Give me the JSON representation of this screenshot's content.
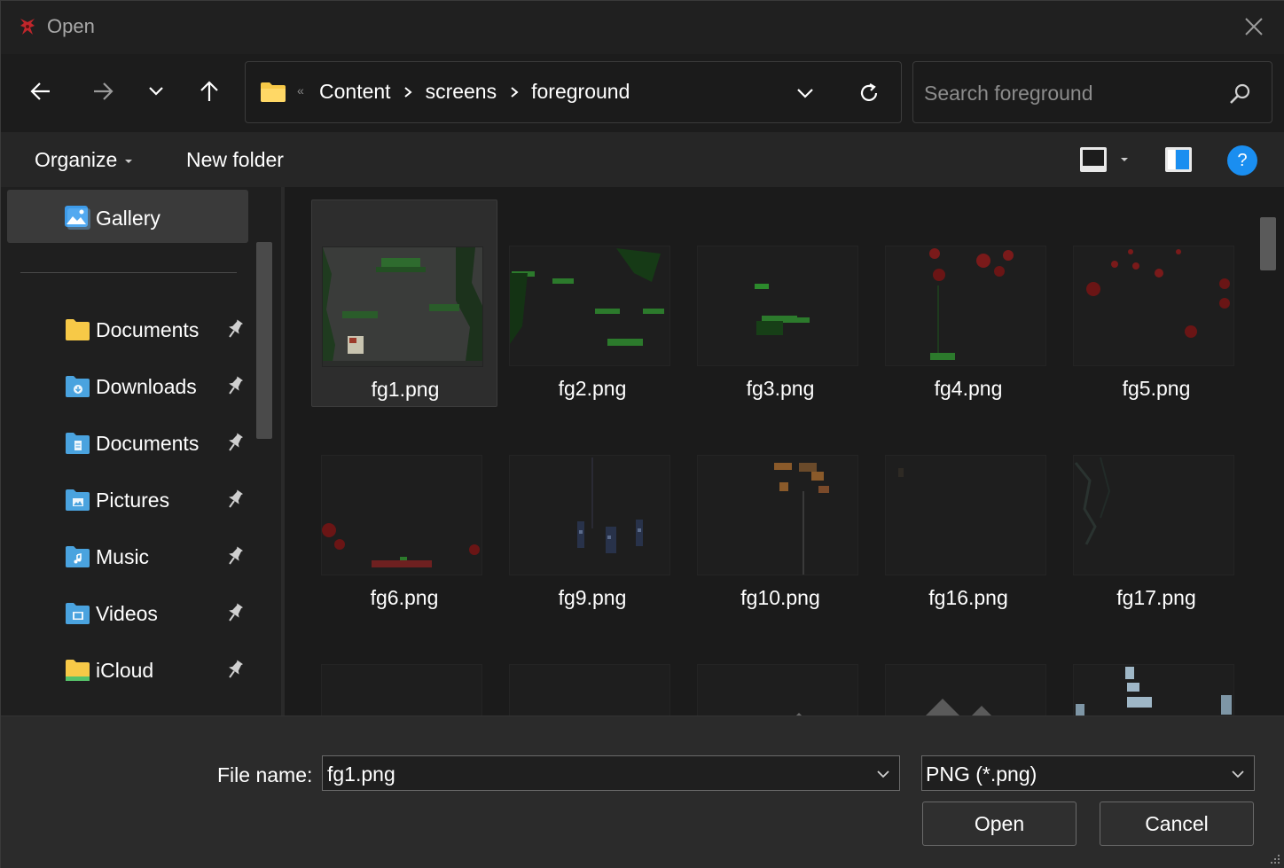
{
  "window": {
    "title": "Open",
    "close_icon": "close-icon",
    "app_icon": "app-icon"
  },
  "nav": {
    "back_icon": "arrow-left-icon",
    "forward_icon": "arrow-right-icon",
    "recent_icon": "chevron-down-icon",
    "up_icon": "arrow-up-icon",
    "address": {
      "overflow_indicator": "«",
      "crumbs": [
        "Content",
        "screens",
        "foreground"
      ]
    },
    "refresh_icon": "refresh-icon",
    "search": {
      "placeholder": "Search foreground"
    }
  },
  "toolbar": {
    "organize_label": "Organize",
    "new_folder_label": "New folder",
    "help_label": "?"
  },
  "sidebar": {
    "gallery_label": "Gallery",
    "items": [
      {
        "label": "Documents",
        "icon": "folder-icon",
        "color": "#f7c948",
        "pinned": true
      },
      {
        "label": "Downloads",
        "icon": "downloads-folder-icon",
        "color": "#4aa3df",
        "pinned": true
      },
      {
        "label": "Documents",
        "icon": "documents-folder-icon",
        "color": "#4aa3df",
        "pinned": true
      },
      {
        "label": "Pictures",
        "icon": "pictures-folder-icon",
        "color": "#4aa3df",
        "pinned": true
      },
      {
        "label": "Music",
        "icon": "music-folder-icon",
        "color": "#4aa3df",
        "pinned": true
      },
      {
        "label": "Videos",
        "icon": "videos-folder-icon",
        "color": "#4aa3df",
        "pinned": true
      },
      {
        "label": "iCloud",
        "icon": "icloud-folder-icon",
        "color": "#f7c948",
        "pinned": true
      }
    ]
  },
  "files": [
    {
      "name": "fg1.png",
      "selected": true
    },
    {
      "name": "fg2.png",
      "selected": false
    },
    {
      "name": "fg3.png",
      "selected": false
    },
    {
      "name": "fg4.png",
      "selected": false
    },
    {
      "name": "fg5.png",
      "selected": false
    },
    {
      "name": "fg6.png",
      "selected": false
    },
    {
      "name": "fg9.png",
      "selected": false
    },
    {
      "name": "fg10.png",
      "selected": false
    },
    {
      "name": "fg16.png",
      "selected": false
    },
    {
      "name": "fg17.png",
      "selected": false
    }
  ],
  "bottom": {
    "file_name_label": "File name:",
    "file_name_value": "fg1.png",
    "file_type_value": "PNG (*.png)",
    "open_label": "Open",
    "cancel_label": "Cancel"
  },
  "colors": {
    "accent": "#1a8ef0",
    "background": "#202020",
    "folder_yellow": "#f7c948",
    "folder_blue": "#4aa3df"
  }
}
